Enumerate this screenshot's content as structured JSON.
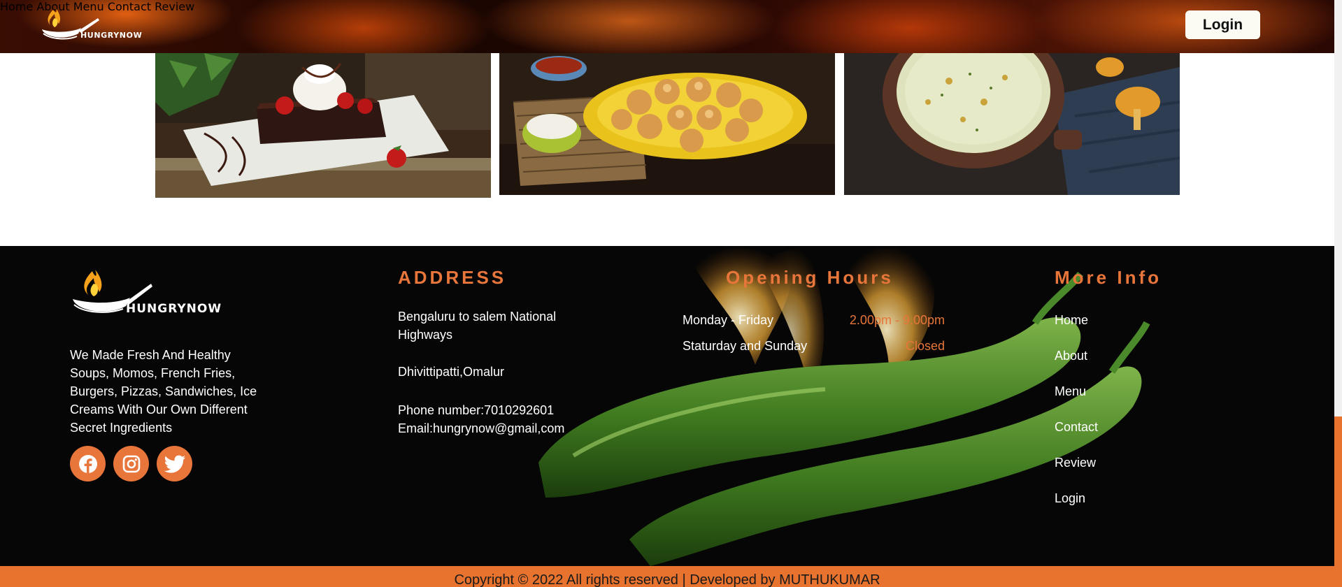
{
  "brand": {
    "name": "HUNGRYNOW"
  },
  "nav": {
    "items": [
      "Home",
      "About",
      "Menu",
      "Contact",
      "Review"
    ],
    "login_label": "Login"
  },
  "gallery": {
    "images": [
      "brownie-with-ice-cream",
      "momos-plate",
      "soup-bowl"
    ]
  },
  "footer": {
    "about_text": "We Made Fresh And Healthy Soups, Momos, French Fries, Burgers, Pizzas, Sandwiches, Ice Creams With Our Own Different Secret Ingredients",
    "social": [
      "facebook-icon",
      "instagram-icon",
      "twitter-icon"
    ],
    "address": {
      "title": "ADDRESS",
      "line1": "Bengaluru to salem National Highways",
      "line2": "Dhivittipatti,Omalur",
      "phone": "Phone number:7010292601",
      "email": "Email:hungrynow@gmail,com"
    },
    "hours": {
      "title": "Opening Hours",
      "rows": [
        {
          "day": "Monday - Friday",
          "time": "2.00pm - 9.00pm"
        },
        {
          "day": "Staturday and Sunday",
          "time": "Closed"
        }
      ]
    },
    "more": {
      "title": "More Info",
      "links": [
        "Home",
        "About",
        "Menu",
        "Contact",
        "Review",
        "Login"
      ]
    },
    "copyright": "Copyright © 2022 All rights reserved | Developed by MUTHUKUMAR"
  },
  "colors": {
    "accent": "#e8763a",
    "footer_bg": "#060606",
    "bar": "#e8732f"
  }
}
